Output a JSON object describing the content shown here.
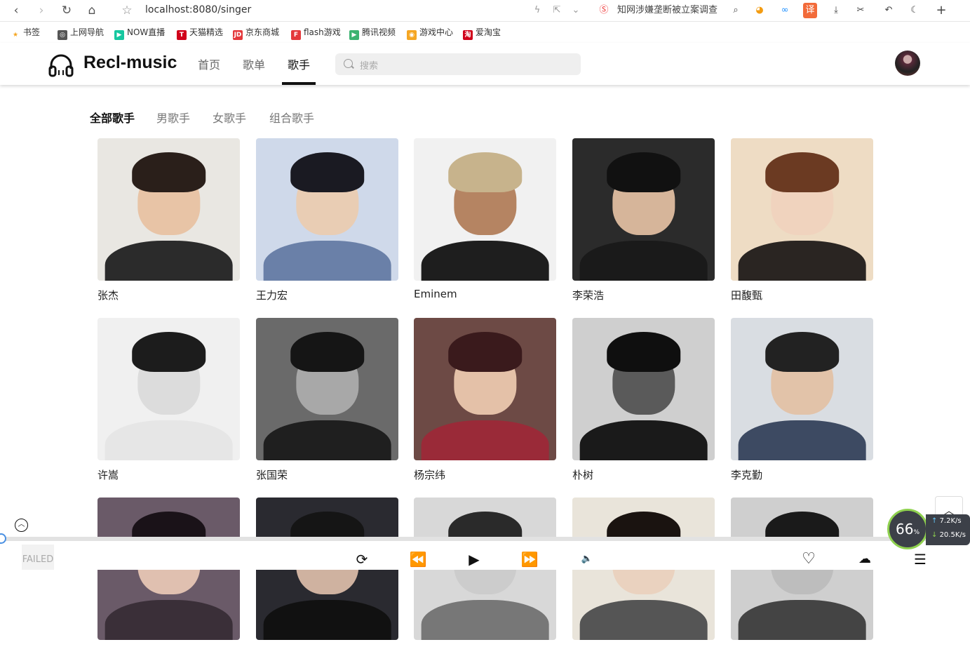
{
  "browser": {
    "url": "localhost:8080/singer",
    "news": "知网涉嫌垄断被立案调查",
    "bookmarks": [
      {
        "label": "书签",
        "color": "#f5a623",
        "glyph": "★"
      },
      {
        "label": "上网导航",
        "color": "#555555",
        "glyph": "◎"
      },
      {
        "label": "NOW直播",
        "color": "#16c7a0",
        "glyph": "▶"
      },
      {
        "label": "天猫精选",
        "color": "#d0021b",
        "glyph": "T"
      },
      {
        "label": "京东商城",
        "color": "#e4393c",
        "glyph": "JD"
      },
      {
        "label": "flash游戏",
        "color": "#e4393c",
        "glyph": "F"
      },
      {
        "label": "腾讯视频",
        "color": "#3cb371",
        "glyph": "▶"
      },
      {
        "label": "游戏中心",
        "color": "#f5a623",
        "glyph": "◉"
      },
      {
        "label": "爱淘宝",
        "color": "#d0021b",
        "glyph": "淘"
      }
    ]
  },
  "header": {
    "brand": "Recl-music",
    "nav": [
      {
        "label": "首页",
        "active": false
      },
      {
        "label": "歌单",
        "active": false
      },
      {
        "label": "歌手",
        "active": true
      }
    ],
    "search_placeholder": "搜索"
  },
  "categories": [
    {
      "label": "全部歌手",
      "active": true
    },
    {
      "label": "男歌手",
      "active": false
    },
    {
      "label": "女歌手",
      "active": false
    },
    {
      "label": "组合歌手",
      "active": false
    }
  ],
  "singers": [
    {
      "name": "张杰",
      "bg": "#e9e7e2",
      "skin": "#e8c4a6",
      "hair": "#2a1f1a",
      "cloth": "#2b2b2b"
    },
    {
      "name": "王力宏",
      "bg": "#cfd9ea",
      "skin": "#e9cdb4",
      "hair": "#1a1a22",
      "cloth": "#6a80a8"
    },
    {
      "name": "Eminem",
      "bg": "#f1f1f1",
      "skin": "#b58462",
      "hair": "#c7b38c",
      "cloth": "#1e1e1e"
    },
    {
      "name": "李荣浩",
      "bg": "#2b2b2b",
      "skin": "#d6b59a",
      "hair": "#111111",
      "cloth": "#1a1a1a"
    },
    {
      "name": "田馥甄",
      "bg": "#eedcc4",
      "skin": "#f0d3be",
      "hair": "#6b3a22",
      "cloth": "#2a2522"
    },
    {
      "name": "许嵩",
      "bg": "#f0f0f0",
      "skin": "#dcdcdc",
      "hair": "#1c1c1c",
      "cloth": "#e6e6e6"
    },
    {
      "name": "张国荣",
      "bg": "#6a6a6a",
      "skin": "#a8a8a8",
      "hair": "#151515",
      "cloth": "#1f1f1f"
    },
    {
      "name": "杨宗纬",
      "bg": "#6d4a45",
      "skin": "#e4c1a8",
      "hair": "#3a1a1c",
      "cloth": "#9a2a38"
    },
    {
      "name": "朴树",
      "bg": "#cfcfcf",
      "skin": "#5a5a5a",
      "hair": "#0f0f0f",
      "cloth": "#1a1a1a"
    },
    {
      "name": "李克勤",
      "bg": "#d9dde2",
      "skin": "#e2c3a9",
      "hair": "#222222",
      "cloth": "#3d4a62"
    },
    {
      "name": "",
      "bg": "#6a5a68",
      "skin": "#e0c0b0",
      "hair": "#1a1218",
      "cloth": "#3a2f38"
    },
    {
      "name": "",
      "bg": "#2a2a30",
      "skin": "#cfb2a0",
      "hair": "#151515",
      "cloth": "#111111"
    },
    {
      "name": "",
      "bg": "#d8d8d8",
      "skin": "#cccccc",
      "hair": "#2a2a2a",
      "cloth": "#777777"
    },
    {
      "name": "",
      "bg": "#e9e4da",
      "skin": "#ead2bf",
      "hair": "#1a1310",
      "cloth": "#555555"
    },
    {
      "name": "",
      "bg": "#cfcfcf",
      "skin": "#bdbdbd",
      "hair": "#1a1a1a",
      "cloth": "#444444"
    }
  ],
  "player": {
    "failed_label": "FAILED"
  },
  "network": {
    "percent": "66",
    "percent_unit": "%",
    "upload": "7.2K/s",
    "download": "20.5K/s"
  }
}
